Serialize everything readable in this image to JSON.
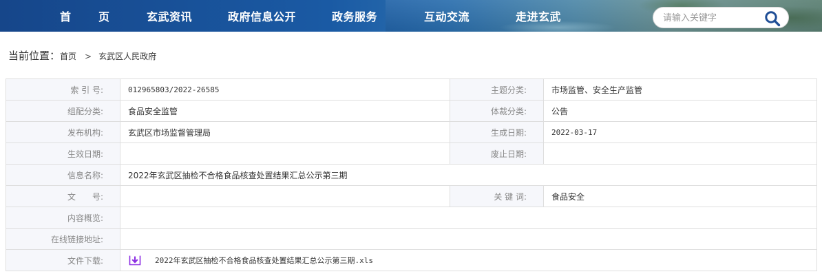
{
  "nav": {
    "items": [
      "首　页",
      "玄武资讯",
      "政府信息公开",
      "政务服务",
      "互动交流",
      "走进玄武"
    ]
  },
  "search": {
    "placeholder": "请输入关键字",
    "icon": "search-icon"
  },
  "breadcrumb": {
    "label": "当前位置：",
    "home": "首页",
    "separator": ">",
    "current": "玄武区人民政府"
  },
  "info": {
    "index_no_label": "索 引 号:",
    "index_no": "012965803/2022-26585",
    "topic_label": "主题分类:",
    "topic": "市场监管、安全生产监管",
    "org_cat_label": "组配分类:",
    "org_cat": "食品安全监管",
    "genre_label": "体裁分类:",
    "genre": "公告",
    "publisher_label": "发布机构:",
    "publisher": "玄武区市场监督管理局",
    "created_label": "生成日期:",
    "created": "2022-03-17",
    "effective_label": "生效日期:",
    "effective": "",
    "abolished_label": "废止日期:",
    "abolished": "",
    "title_label": "信息名称:",
    "title": "2022年玄武区抽检不合格食品核查处置结果汇总公示第三期",
    "doc_no_label": "文　　号:",
    "doc_no": "",
    "keywords_label": "关 键 词:",
    "keywords": "食品安全",
    "summary_label": "内容概览:",
    "summary": "",
    "link_label": "在线链接地址:",
    "link": "",
    "download_label": "文件下载:",
    "download_file": "2022年玄武区抽检不合格食品核查处置结果汇总公示第三期.xls",
    "download_icon": "download-icon"
  },
  "colors": {
    "nav_bg": "#1a5aa4",
    "label_bg": "#f6f7fb",
    "label_text": "#888888",
    "border": "#dedede",
    "accent_purple": "#8a2be2",
    "search_icon": "#1f4e96"
  }
}
